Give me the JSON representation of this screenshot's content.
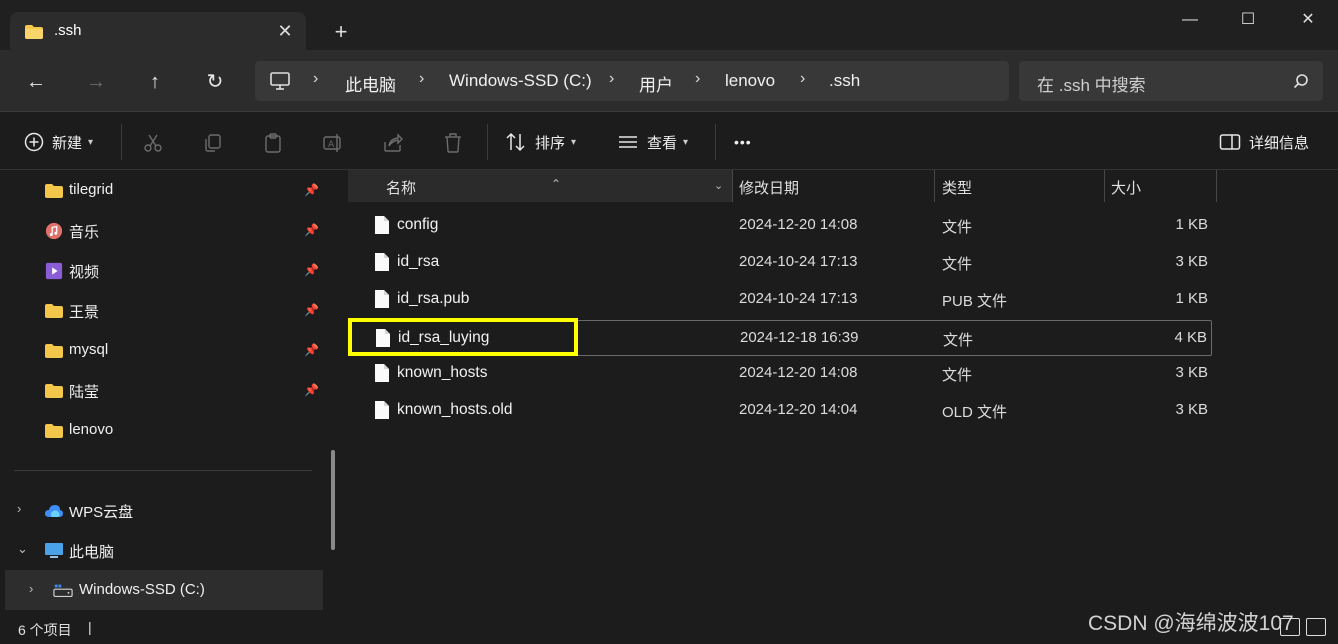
{
  "tab": {
    "title": ".ssh",
    "close": "✕",
    "new_tab": "+"
  },
  "window": {
    "minimize": "—",
    "maximize": "☐",
    "close": "✕"
  },
  "nav": {
    "back": "←",
    "forward": "→",
    "up": "↑",
    "refresh": "↻"
  },
  "breadcrumb": [
    "此电脑",
    "Windows-SSD (C:)",
    "用户",
    "lenovo",
    ".ssh"
  ],
  "breadcrumb_separator": "›",
  "search": {
    "placeholder": "在 .ssh 中搜索"
  },
  "toolbar": {
    "new_label": "新建",
    "sort_label": "排序",
    "view_label": "查看",
    "more_label": "•••",
    "details_label": "详细信息"
  },
  "sidebar": {
    "quick_access": [
      {
        "label": "tilegrid",
        "icon": "folder-icon",
        "pinned": true
      },
      {
        "label": "音乐",
        "icon": "music-icon",
        "pinned": true
      },
      {
        "label": "视频",
        "icon": "video-icon",
        "pinned": true
      },
      {
        "label": "王景",
        "icon": "folder-icon",
        "pinned": true
      },
      {
        "label": "mysql",
        "icon": "folder-icon",
        "pinned": true
      },
      {
        "label": "陆莹",
        "icon": "folder-icon",
        "pinned": true
      },
      {
        "label": "lenovo",
        "icon": "folder-icon",
        "pinned": false
      }
    ],
    "locations": [
      {
        "label": "WPS云盘",
        "icon": "cloud-icon",
        "expanded": false
      },
      {
        "label": "此电脑",
        "icon": "computer-icon",
        "expanded": true
      },
      {
        "label": "Windows-SSD (C:)",
        "icon": "drive-icon",
        "expanded": false,
        "selected": true
      }
    ],
    "expander_collapsed": "›",
    "expander_expanded": "⌄"
  },
  "columns": {
    "name": "名称",
    "modified": "修改日期",
    "type": "类型",
    "size": "大小"
  },
  "files": [
    {
      "name": "config",
      "modified": "2024-12-20 14:08",
      "type": "文件",
      "size": "1 KB"
    },
    {
      "name": "id_rsa",
      "modified": "2024-10-24 17:13",
      "type": "文件",
      "size": "3 KB"
    },
    {
      "name": "id_rsa.pub",
      "modified": "2024-10-24 17:13",
      "type": "PUB 文件",
      "size": "1 KB"
    },
    {
      "name": "id_rsa_luying",
      "modified": "2024-12-18 16:39",
      "type": "文件",
      "size": "4 KB",
      "selected": true
    },
    {
      "name": "known_hosts",
      "modified": "2024-12-20 14:08",
      "type": "文件",
      "size": "3 KB"
    },
    {
      "name": "known_hosts.old",
      "modified": "2024-12-20 14:04",
      "type": "OLD 文件",
      "size": "3 KB"
    }
  ],
  "status": {
    "count": "6 个项目",
    "caret": "|"
  },
  "watermark": "CSDN @海绵波波107",
  "colors": {
    "highlight": "#ffff00",
    "folder": "#f3c74a",
    "background": "#1c1c1c"
  }
}
